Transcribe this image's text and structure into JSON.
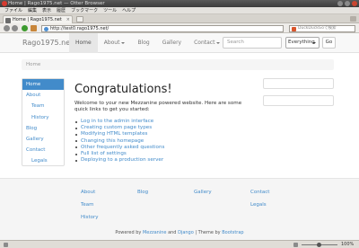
{
  "window": {
    "title": "Home | Rago1975.net — Otter Browser"
  },
  "menubar": [
    "ファイル",
    "編集",
    "表示",
    "履歴",
    "ブックマーク",
    "ツール",
    "ヘルプ"
  ],
  "tab": {
    "title": "Home | Rago1975.net"
  },
  "toolbar": {
    "url": "http://test0.rago1975.net/",
    "search_placeholder": "DuckDuckGoで検索"
  },
  "site": {
    "brand": "Rago1975.net",
    "nav": [
      {
        "label": "Home",
        "active": true,
        "dropdown": false
      },
      {
        "label": "About",
        "active": false,
        "dropdown": true
      },
      {
        "label": "Blog",
        "active": false,
        "dropdown": false
      },
      {
        "label": "Gallery",
        "active": false,
        "dropdown": false
      },
      {
        "label": "Contact",
        "active": false,
        "dropdown": true
      }
    ],
    "search_placeholder": "Search",
    "search_scope": "Everything",
    "go_label": "Go"
  },
  "breadcrumb": "Home",
  "sidebar": [
    {
      "label": "Home",
      "active": true,
      "sub": false
    },
    {
      "label": "About",
      "active": false,
      "sub": false
    },
    {
      "label": "Team",
      "active": false,
      "sub": true
    },
    {
      "label": "History",
      "active": false,
      "sub": true
    },
    {
      "label": "Blog",
      "active": false,
      "sub": false
    },
    {
      "label": "Gallery",
      "active": false,
      "sub": false
    },
    {
      "label": "Contact",
      "active": false,
      "sub": false
    },
    {
      "label": "Legals",
      "active": false,
      "sub": true
    }
  ],
  "main": {
    "heading": "Congratulations!",
    "lead": "Welcome to your new Mezzanine powered website. Here are some quick links to get you started:",
    "links": [
      "Log in to the admin interface",
      "Creating custom page types",
      "Modifying HTML templates",
      "Changing this homepage",
      "Other frequently asked questions",
      "Full list of settings",
      "Deploying to a production server"
    ]
  },
  "footer": {
    "columns": [
      [
        "About",
        "Team",
        "History"
      ],
      [
        "Blog"
      ],
      [
        "Gallery"
      ],
      [
        "Contact",
        "Legals"
      ]
    ],
    "credits": {
      "powered_by": "Powered by",
      "mezzanine": "Mezzanine",
      "and": "and",
      "django": "Django",
      "sep": "|",
      "theme_by": "Theme by",
      "bootstrap": "Bootstrap"
    }
  },
  "statusbar": {
    "zoom": "100%"
  }
}
